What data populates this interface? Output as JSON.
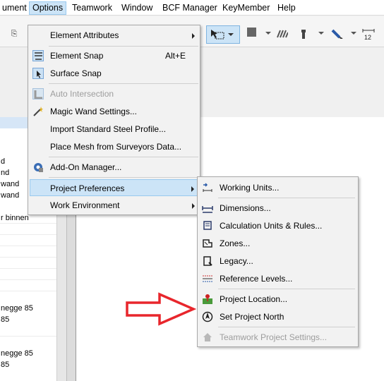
{
  "menubar": {
    "items": [
      {
        "label": "ument"
      },
      {
        "label": "Options",
        "active": true
      },
      {
        "label": "Teamwork"
      },
      {
        "label": "Window"
      },
      {
        "label": "BCF Manager"
      },
      {
        "label": "KeyMember"
      },
      {
        "label": "Help"
      }
    ]
  },
  "options_menu": {
    "items": [
      {
        "label": "Element Attributes",
        "icon": "none",
        "submenu": true
      },
      {
        "label": "Element Snap",
        "shortcut": "Alt+E",
        "icon": "element-snap-icon"
      },
      {
        "label": "Surface Snap",
        "icon": "surface-snap-icon"
      },
      {
        "label": "Auto Intersection",
        "icon": "auto-intersection-icon",
        "disabled": true
      },
      {
        "label": "Magic Wand Settings...",
        "icon": "magic-wand-icon"
      },
      {
        "label": "Import Standard Steel Profile...",
        "icon": "none"
      },
      {
        "label": "Place Mesh from Surveyors Data...",
        "icon": "none"
      },
      {
        "label": "Add-On Manager...",
        "icon": "add-on-manager-icon"
      },
      {
        "label": "Project Preferences",
        "icon": "none",
        "submenu": true,
        "highlighted": true
      },
      {
        "label": "Work Environment",
        "icon": "none",
        "submenu": true
      }
    ]
  },
  "preferences_submenu": {
    "items": [
      {
        "label": "Working Units...",
        "icon": "working-units-icon"
      },
      {
        "label": "Dimensions...",
        "icon": "dimensions-icon"
      },
      {
        "label": "Calculation Units & Rules...",
        "icon": "calculation-units-icon"
      },
      {
        "label": "Zones...",
        "icon": "zones-icon"
      },
      {
        "label": "Legacy...",
        "icon": "legacy-icon"
      },
      {
        "label": "Reference Levels...",
        "icon": "reference-levels-icon"
      },
      {
        "label": "Project Location...",
        "icon": "project-location-icon"
      },
      {
        "label": "Set Project North",
        "icon": "project-north-icon"
      },
      {
        "label": "Teamwork Project Settings...",
        "icon": "teamwork-settings-icon",
        "disabled": true
      }
    ]
  },
  "left_list": {
    "rows": [
      "d",
      "nd",
      "wand",
      "wand",
      "r binnen",
      "",
      "",
      "",
      "",
      "",
      "",
      "",
      "",
      "negge 85",
      "85",
      "",
      "",
      "negge 85",
      "85"
    ]
  },
  "colors": {
    "highlight": "#cce4f7",
    "highlight_border": "#99c9ef",
    "annotation_arrow": "#e8262c"
  }
}
